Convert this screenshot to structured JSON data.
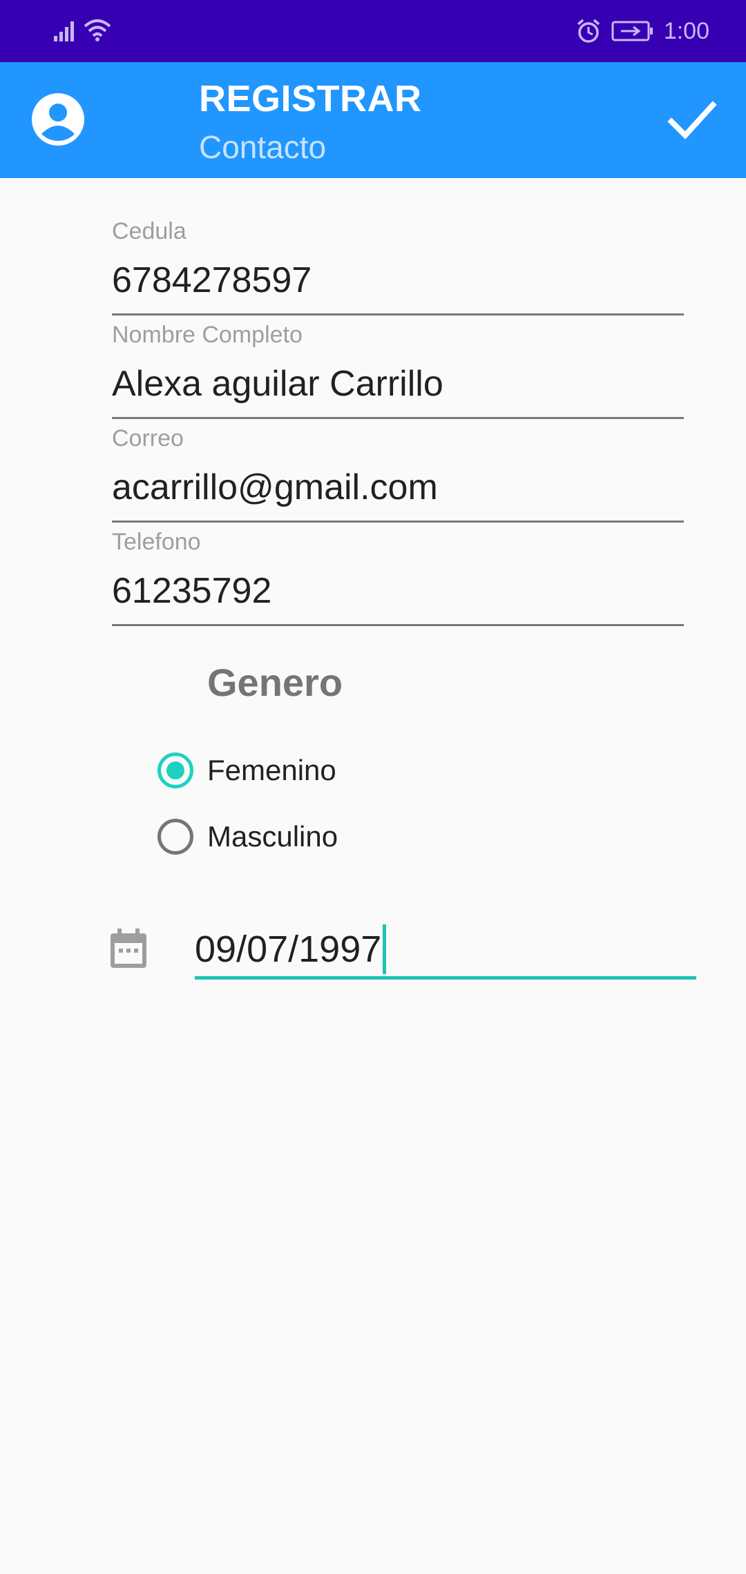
{
  "status_bar": {
    "time": "1:00",
    "icons": [
      "signal-icon",
      "wifi-icon",
      "alarm-icon",
      "battery-icon"
    ]
  },
  "app_bar": {
    "title": "REGISTRAR",
    "subtitle": "Contacto",
    "left_icon": "account-circle-icon",
    "right_icon": "check-icon",
    "color": "#2196ff"
  },
  "form": {
    "cedula": {
      "label": "Cedula",
      "value": "6784278597"
    },
    "nombre": {
      "label": "Nombre Completo",
      "value": "Alexa aguilar Carrillo"
    },
    "correo": {
      "label": "Correo",
      "value": "acarrillo@gmail.com"
    },
    "telefono": {
      "label": "Telefono",
      "value": "61235792"
    }
  },
  "genero": {
    "label": "Genero",
    "options": [
      {
        "label": "Femenino",
        "selected": true
      },
      {
        "label": "Masculino",
        "selected": false
      }
    ],
    "accent": "#1dd1c1"
  },
  "fecha": {
    "icon": "calendar-icon",
    "value": "09/07/1997"
  }
}
